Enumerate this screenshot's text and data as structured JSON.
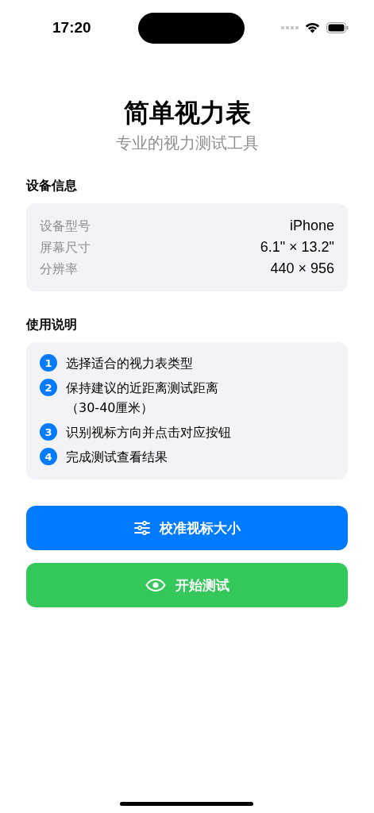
{
  "status_bar": {
    "time": "17:20"
  },
  "header": {
    "title": "简单视力表",
    "subtitle": "专业的视力测试工具"
  },
  "device_info": {
    "heading": "设备信息",
    "rows": [
      {
        "label": "设备型号",
        "value": "iPhone"
      },
      {
        "label": "屏幕尺寸",
        "value": "6.1\" × 13.2\""
      },
      {
        "label": "分辨率",
        "value": "440 × 956"
      }
    ]
  },
  "instructions": {
    "heading": "使用说明",
    "steps": [
      {
        "number": "1",
        "lines": [
          "选择适合的视力表类型"
        ]
      },
      {
        "number": "2",
        "lines": [
          "保持建议的近距离测试距离",
          "（30-40厘米）"
        ]
      },
      {
        "number": "3",
        "lines": [
          "识别视标方向并点击对应按钮"
        ]
      },
      {
        "number": "4",
        "lines": [
          "完成测试查看结果"
        ]
      }
    ]
  },
  "buttons": [
    {
      "kind": "calibrate",
      "label": "校准视标大小"
    },
    {
      "kind": "start",
      "label": "开始测试"
    }
  ]
}
